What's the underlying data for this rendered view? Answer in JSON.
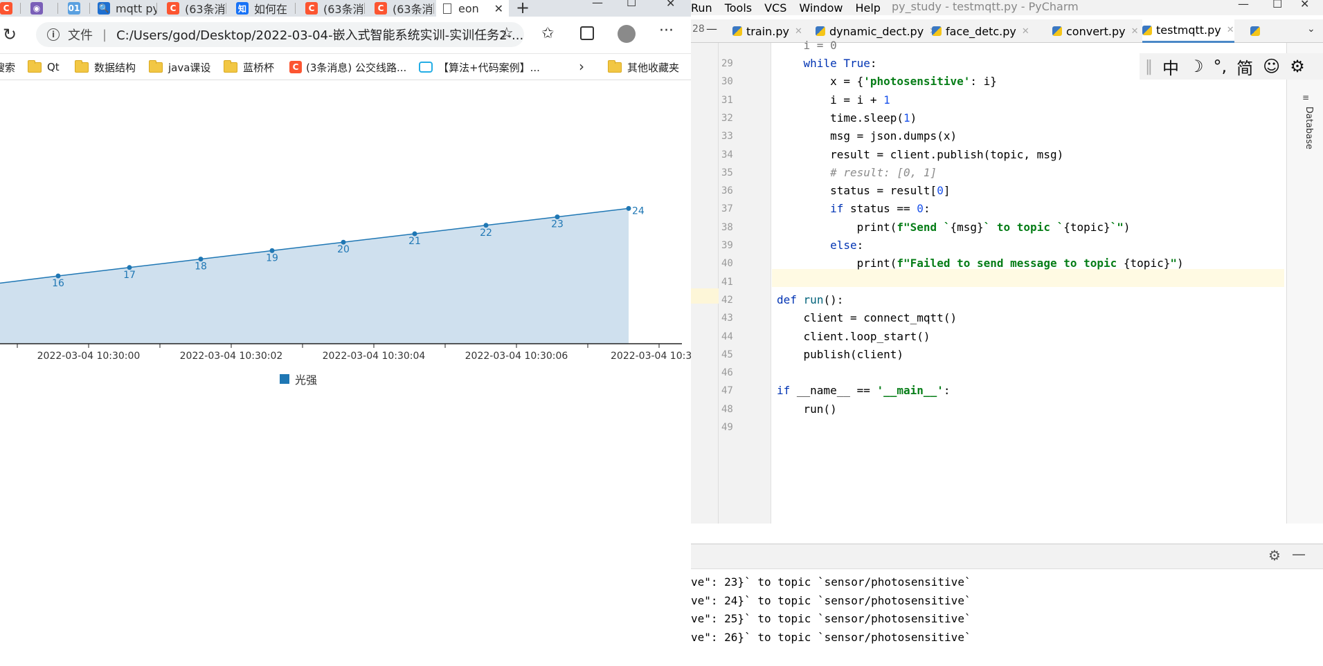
{
  "browser": {
    "tabs": [
      {
        "label": "",
        "icon": "csdn-icon"
      },
      {
        "label": "",
        "icon": "circle-icon"
      },
      {
        "label": "",
        "icon": "01-icon"
      },
      {
        "label": "mqtt py",
        "icon": "search-icon"
      },
      {
        "label": "(63条消",
        "icon": "csdn-icon"
      },
      {
        "label": "如何在",
        "icon": "zhihu-icon"
      },
      {
        "label": "(63条消",
        "icon": "csdn-icon"
      },
      {
        "label": "(63条消",
        "icon": "csdn-icon"
      }
    ],
    "active_tab": "eon",
    "new_tab_glyph": "+",
    "address_prefix": "文件",
    "address": "C:/Users/god/Desktop/2022-03-04-嵌入式智能系统实训-实训任务2-...",
    "bookmarks": [
      {
        "label": "搜索",
        "icon": "none"
      },
      {
        "label": "Qt",
        "icon": "folder-icon"
      },
      {
        "label": "数据结构",
        "icon": "folder-icon"
      },
      {
        "label": "java课设",
        "icon": "folder-icon"
      },
      {
        "label": "蓝桥杯",
        "icon": "folder-icon"
      },
      {
        "label": "(3条消息) 公交线路...",
        "icon": "csdn-icon"
      },
      {
        "label": "【算法+代码案例】...",
        "icon": "bilibili-icon"
      }
    ],
    "other_bookmarks": "其他收藏夹"
  },
  "chart_data": {
    "type": "area",
    "title": "",
    "series": [
      {
        "name": "光强",
        "color": "#1f77b4",
        "fill": "#cfe0ee",
        "points": [
          {
            "label": "16",
            "value": 16
          },
          {
            "label": "17",
            "value": 17
          },
          {
            "label": "18",
            "value": 18
          },
          {
            "label": "19",
            "value": 19
          },
          {
            "label": "20",
            "value": 20
          },
          {
            "label": "21",
            "value": 21
          },
          {
            "label": "22",
            "value": 22
          },
          {
            "label": "23",
            "value": 23
          },
          {
            "label": "24",
            "value": 24
          }
        ]
      }
    ],
    "x_ticks": [
      "2022-03-04 10:30:00",
      "2022-03-04 10:30:02",
      "2022-03-04 10:30:04",
      "2022-03-04 10:30:06",
      "2022-03-04 10:3"
    ],
    "legend": "光强"
  },
  "ide": {
    "menus": [
      "Run",
      "Tools",
      "VCS",
      "Window",
      "Help"
    ],
    "title": "py_study - testmqtt.py - PyCharm",
    "file_tabs": [
      "train.py",
      "dynamic_dect.py",
      "face_detc.py",
      "convert.py",
      "testmqtt.py"
    ],
    "active_file": "testmqtt.py",
    "side_label": "Database",
    "ime": [
      "中",
      "☽",
      "°,",
      "简",
      "☺",
      "⚙"
    ],
    "code_lines": [
      {
        "n": "29",
        "html": "    <span class='kw'>while</span> <span class='kw'>True</span>:"
      },
      {
        "n": "30",
        "html": "        x = {<span class='str'>'photosensitive'</span>: i}"
      },
      {
        "n": "31",
        "html": "        i = i + <span class='num'>1</span>"
      },
      {
        "n": "32",
        "html": "        time.sleep(<span class='num'>1</span>)"
      },
      {
        "n": "33",
        "html": "        msg = json.dumps(x)"
      },
      {
        "n": "34",
        "html": "        result = client.publish(topic, msg)"
      },
      {
        "n": "35",
        "html": "        <span class='cm'># result: [0, 1]</span>"
      },
      {
        "n": "36",
        "html": "        status = result[<span class='num'>0</span>]"
      },
      {
        "n": "37",
        "html": "        <span class='kw'>if</span> status == <span class='num'>0</span>:"
      },
      {
        "n": "38",
        "html": "            print(<span class='str'>f\"Send `</span>{msg}<span class='str'>` to topic `</span>{topic}<span class='str'>`\"</span>)"
      },
      {
        "n": "39",
        "html": "        <span class='kw'>else</span>:"
      },
      {
        "n": "40",
        "html": "            print(<span class='str'>f\"Failed to send message to topic </span>{topic}<span class='str'>\"</span>)"
      },
      {
        "n": "41",
        "html": ""
      },
      {
        "n": "42",
        "html": "<span class='kw'>def</span> <span class='fn'>run</span>():"
      },
      {
        "n": "43",
        "html": "    client = connect_mqtt()"
      },
      {
        "n": "44",
        "html": "    client.loop_start()"
      },
      {
        "n": "45",
        "html": "    publish(client)"
      },
      {
        "n": "46",
        "html": ""
      },
      {
        "n": "47",
        "html": "<span class='kw'>if</span> __name__ == <span class='str'>'__main__'</span>:"
      },
      {
        "n": "48",
        "html": "    run()"
      },
      {
        "n": "49",
        "html": ""
      }
    ],
    "output_lines": [
      "ve\": 23}` to topic `sensor/photosensitive`",
      "ve\": 24}` to topic `sensor/photosensitive`",
      "ve\": 25}` to topic `sensor/photosensitive`",
      "ve\": 26}` to topic `sensor/photosensitive`"
    ]
  }
}
